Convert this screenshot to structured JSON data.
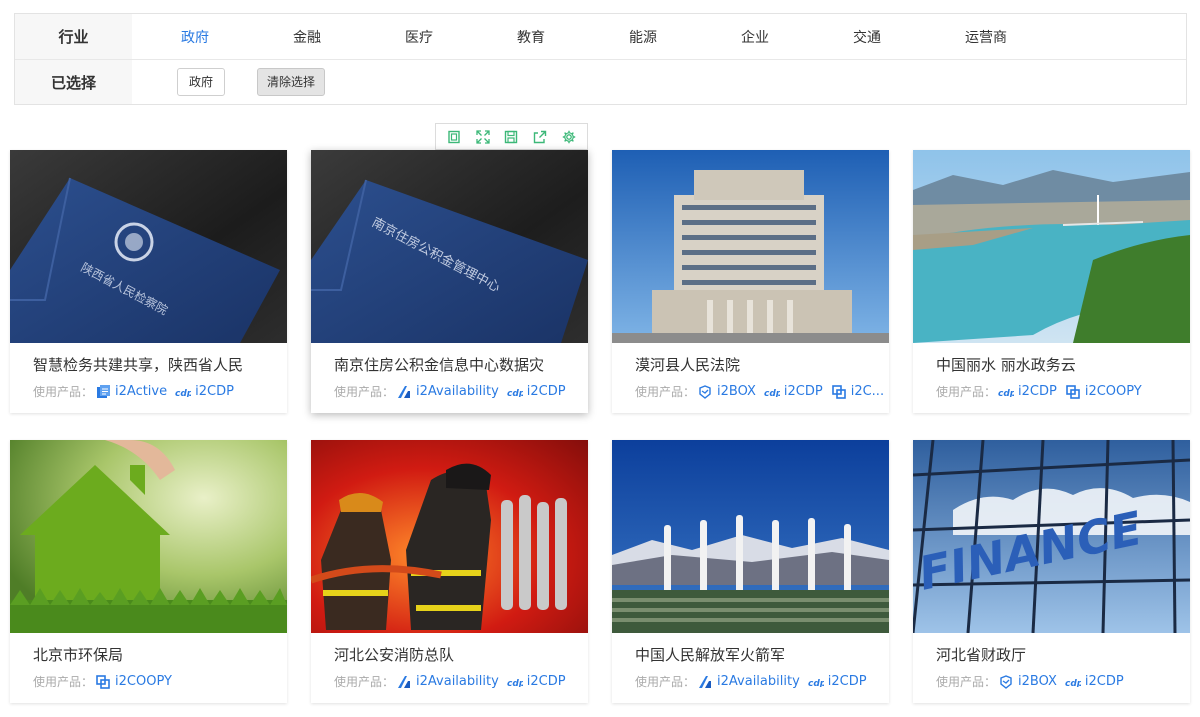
{
  "filters": {
    "industry_label": "行业",
    "industries": [
      "政府",
      "金融",
      "医疗",
      "教育",
      "能源",
      "企业",
      "交通",
      "运营商"
    ],
    "active_industry": "政府",
    "selected_label": "已选择",
    "selected_tag": "政府",
    "clear_label": "清除选择"
  },
  "toolbar": {
    "icons": [
      "copy-icon",
      "expand-icon",
      "save-icon",
      "share-icon",
      "settings-icon"
    ]
  },
  "products_prefix": "使用产品：",
  "colors": {
    "accent": "#2a7ae2",
    "toolbar_icon": "#3cb878"
  },
  "cards": [
    {
      "title": "智慧检务共建共享，陕西省人民",
      "image": "blue-book-shaanxi-procuratorate",
      "products": [
        {
          "name": "i2Active",
          "icon": "active-icon"
        },
        {
          "name": "i2CDP",
          "icon": "cdp-icon"
        }
      ]
    },
    {
      "title": "南京住房公积金信息中心数据灾",
      "image": "blue-book-nanjing-housing-fund",
      "products": [
        {
          "name": "i2Availability",
          "icon": "availability-icon"
        },
        {
          "name": "i2CDP",
          "icon": "cdp-icon"
        }
      ]
    },
    {
      "title": "漠河县人民法院",
      "image": "court-building",
      "products": [
        {
          "name": "i2BOX",
          "icon": "box-icon"
        },
        {
          "name": "i2CDP",
          "icon": "cdp-icon"
        },
        {
          "name": "i2C...",
          "icon": "coopy-icon"
        }
      ]
    },
    {
      "title": "中国丽水 丽水政务云",
      "image": "lishui-river-landscape",
      "products": [
        {
          "name": "i2CDP",
          "icon": "cdp-icon"
        },
        {
          "name": "i2COOPY",
          "icon": "coopy-icon"
        }
      ]
    },
    {
      "title": "北京市环保局",
      "image": "grass-house",
      "products": [
        {
          "name": "i2COOPY",
          "icon": "coopy-icon"
        }
      ]
    },
    {
      "title": "河北公安消防总队",
      "image": "firefighters",
      "products": [
        {
          "name": "i2Availability",
          "icon": "availability-icon"
        },
        {
          "name": "i2CDP",
          "icon": "cdp-icon"
        }
      ]
    },
    {
      "title": "中国人民解放军火箭军",
      "image": "rocket-force-parade",
      "products": [
        {
          "name": "i2Availability",
          "icon": "availability-icon"
        },
        {
          "name": "i2CDP",
          "icon": "cdp-icon"
        }
      ]
    },
    {
      "title": "河北省财政厅",
      "image": "finance-building",
      "products": [
        {
          "name": "i2BOX",
          "icon": "box-icon"
        },
        {
          "name": "i2CDP",
          "icon": "cdp-icon"
        }
      ]
    }
  ]
}
